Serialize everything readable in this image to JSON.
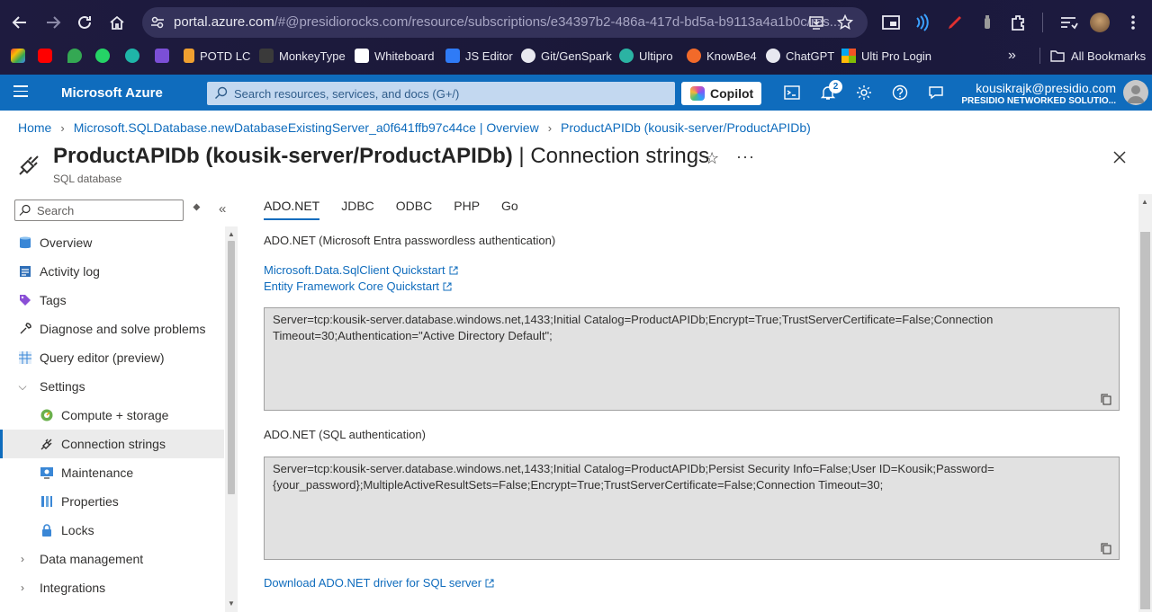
{
  "browser": {
    "url_host": "portal.azure.com",
    "url_rest": "/#@presidiorocks.com/resource/subscriptions/e34397b2-486a-417d-bd5a-b9113a4a1b0c/res...",
    "bookmarks": [
      "POTD LC",
      "MonkeyType",
      "Whiteboard",
      "JS Editor",
      "Git/GenSpark",
      "Ultipro",
      "KnowBe4",
      "ChatGPT",
      "Ulti Pro Login"
    ],
    "overflow": "»",
    "all_bookmarks": "All Bookmarks"
  },
  "azure": {
    "brand": "Microsoft Azure",
    "search_placeholder": "Search resources, services, and docs (G+/)",
    "copilot_label": "Copilot",
    "notification_count": "2",
    "account_email": "kousikrajk@presidio.com",
    "account_org": "PRESIDIO NETWORKED SOLUTIO..."
  },
  "breadcrumb": {
    "items": [
      "Home",
      "Microsoft.SQLDatabase.newDatabaseExistingServer_a0f641ffb97c44ce | Overview",
      "ProductAPIDb (kousik-server/ProductAPIDb)"
    ]
  },
  "header": {
    "title_main": "ProductAPIDb (kousik-server/ProductAPIDb)",
    "title_section": " | Connection strings",
    "subtitle": "SQL database",
    "more": "···"
  },
  "sidebar": {
    "search_placeholder": "Search",
    "items": [
      {
        "label": "Overview"
      },
      {
        "label": "Activity log"
      },
      {
        "label": "Tags"
      },
      {
        "label": "Diagnose and solve problems"
      },
      {
        "label": "Query editor (preview)"
      },
      {
        "label": "Settings"
      },
      {
        "label": "Compute + storage"
      },
      {
        "label": "Connection strings"
      },
      {
        "label": "Maintenance"
      },
      {
        "label": "Properties"
      },
      {
        "label": "Locks"
      },
      {
        "label": "Data management"
      },
      {
        "label": "Integrations"
      }
    ]
  },
  "main": {
    "tabs": [
      "ADO.NET",
      "JDBC",
      "ODBC",
      "PHP",
      "Go"
    ],
    "section1_label": "ADO.NET (Microsoft Entra passwordless authentication)",
    "link1": "Microsoft.Data.SqlClient Quickstart",
    "link2": "Entity Framework Core Quickstart",
    "conn1_line1": "Server=tcp:kousik-server.database.windows.net,1433;Initial Catalog=ProductAPIDb;Encrypt=True;TrustServerCertificate=False;Connection",
    "conn1_line2": "Timeout=30;Authentication=\"Active Directory Default\";",
    "section2_label": "ADO.NET (SQL authentication)",
    "conn2_line1": "Server=tcp:kousik-server.database.windows.net,1433;Initial Catalog=ProductAPIDb;Persist Security Info=False;User ID=Kousik;Password=",
    "conn2_line2": "{your_password};MultipleActiveResultSets=False;Encrypt=True;TrustServerCertificate=False;Connection Timeout=30;",
    "download_link": "Download ADO.NET driver for SQL server"
  },
  "colors": {
    "azure_blue": "#0f6cbd",
    "browser_bg": "#1c1a3e"
  }
}
